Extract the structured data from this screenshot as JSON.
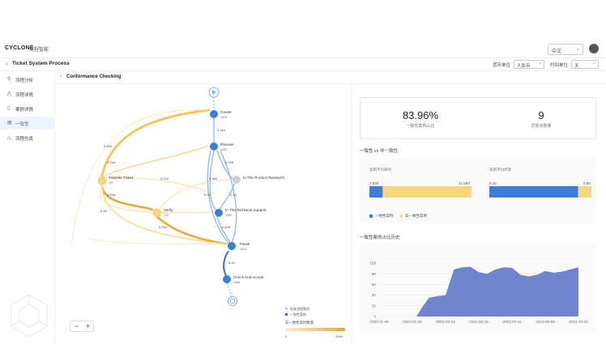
{
  "header": {
    "logo_text": "CYCLONE",
    "product": "流程智能",
    "language": "中文"
  },
  "titlebar": {
    "title": "Ticket System Process",
    "currency_label": "货币单位",
    "currency_value": "人民币",
    "time_label": "时间单位",
    "time_value": "天"
  },
  "sidebar": {
    "items": [
      {
        "label": "流程分析",
        "icon": "pin-icon"
      },
      {
        "label": "流程详情",
        "icon": "flow-icon"
      },
      {
        "label": "案例详情",
        "icon": "document-icon"
      },
      {
        "label": "一致性",
        "icon": "checklist-icon"
      },
      {
        "label": "流程仿真",
        "icon": "simulation-icon"
      }
    ]
  },
  "main": {
    "title": "Conformance Checking"
  },
  "process_map": {
    "nodes": [
      {
        "id": "create",
        "label": "Create",
        "count": "1528"
      },
      {
        "id": "receive",
        "label": "Receive",
        "count": "1453"
      },
      {
        "id": "transfer",
        "label": "Transfer Ticket",
        "count": "197"
      },
      {
        "id": "product",
        "label": "In The Product Research...",
        "count": ""
      },
      {
        "id": "verify",
        "label": "Verify",
        "count": "132"
      },
      {
        "id": "support",
        "label": "In The Technical Support",
        "count": "1469"
      },
      {
        "id": "finish",
        "label": "Finish",
        "count": "1528"
      },
      {
        "id": "accept",
        "label": "Check And Accept",
        "count": "1468"
      }
    ],
    "edge_labels": [
      "0.11d",
      "0.45d",
      "0.15d",
      "0.11d",
      "0.04d",
      "0.36d",
      "0.4d",
      "0.53d",
      "0.1d",
      "0.4d",
      "0.24d",
      "0.52d",
      "6.2d"
    ],
    "legend": {
      "standard": "标准流程路径",
      "conform": "一致性案例",
      "nonconform": "非一致性案例数量",
      "min": "0",
      "max": "1534"
    }
  },
  "stats": {
    "rate_value": "83.96%",
    "rate_label": "一致性案例占比",
    "anomaly_value": "9",
    "anomaly_label": "异常点数量"
  },
  "comparison": {
    "title": "一致性 vs 非一致性",
    "duration_label": "案例平均耗时",
    "duration_conform": "3.53d",
    "duration_nonconform": "21.69d",
    "duration_share": 0.13,
    "steps_label": "案例平均步骤",
    "steps_conform": "6.15",
    "steps_nonconform": "0.88",
    "steps_share": 0.87,
    "legend_conform": "一致性案例",
    "legend_nonconform": "非一致性案例"
  },
  "colors": {
    "conform": "#3b7dd8",
    "nonconform": "#f6d77c",
    "accent": "#2f74d0",
    "area": "#6f86cf"
  },
  "history_title": "一致性案例占比历史",
  "chart_data": {
    "type": "area",
    "title": "",
    "xlabel": "",
    "ylabel": "",
    "ylim": [
      0,
      100
    ],
    "yticks": [
      0,
      20,
      40,
      60,
      80,
      100
    ],
    "xticks": [
      "2020-11-29",
      "2021-01-24",
      "2021-03-21",
      "2021-05-16",
      "2021-07-11",
      "2021-09-05",
      "2021-10-31"
    ],
    "x": [
      "2020-11-29",
      "2020-12-20",
      "2021-01-10",
      "2021-01-31",
      "2021-02-10",
      "2021-02-21",
      "2021-03-07",
      "2021-03-21",
      "2021-04-04",
      "2021-04-18",
      "2021-05-02",
      "2021-05-16",
      "2021-05-30",
      "2021-06-13",
      "2021-06-27",
      "2021-07-11",
      "2021-07-25",
      "2021-08-08",
      "2021-08-22",
      "2021-09-05",
      "2021-09-19",
      "2021-10-03",
      "2021-10-17",
      "2021-10-31"
    ],
    "series": [
      {
        "values": [
          0,
          0,
          0,
          0,
          18,
          35,
          38,
          40,
          88,
          92,
          93,
          83,
          80,
          88,
          92,
          91,
          78,
          75,
          78,
          85,
          82,
          84,
          88,
          92
        ]
      }
    ]
  }
}
